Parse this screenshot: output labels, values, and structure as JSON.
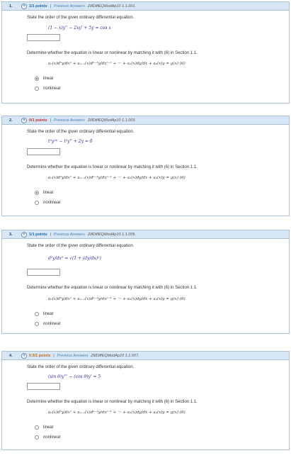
{
  "questions": [
    {
      "number": "1.",
      "points": "1/1 points",
      "prev": "Previous Answers",
      "code": "ZillDiffEQModAp10 1.1.001.",
      "prompt": "State the order of the given ordinary differential equation.",
      "equation": "(1 − x)y'' − 2xy' + 5y = cos x",
      "linear_prompt": "Determine whether the equation is linear or nonlinear by matching it with (6) in Section 1.1.",
      "general": "aₙ(x)dⁿy/dxⁿ + aₙ₋₁(x)dⁿ⁻¹y/dxⁿ⁻¹ + ··· + a₁(x)dy/dx + a₀(x)y = g(x)   (6)",
      "options": [
        "linear",
        "nonlinear"
      ],
      "selected": "linear"
    },
    {
      "number": "2.",
      "points": "0/1 points",
      "prev": "Previous Answers",
      "code": "ZillDiffEQModAp10 1.1.003.",
      "prompt": "State the order of the given ordinary differential equation.",
      "equation": "t⁵y⁽⁴⁾ − t³y'' + 2y = 0",
      "linear_prompt": "Determine whether the equation is linear or nonlinear by matching it with (6) in Section 1.1.",
      "general": "aₙ(x)dⁿy/dxⁿ + aₙ₋₁(x)dⁿ⁻¹y/dxⁿ⁻¹ + ··· + a₁(x)dy/dx + a₀(x)y = g(x)   (6)",
      "options": [
        "linear",
        "nonlinear"
      ],
      "selected": "linear"
    },
    {
      "number": "3.",
      "points": "1/1 points",
      "prev": "Previous Answers",
      "code": "ZillDiffEQModAp10 1.1.005.",
      "prompt": "State the order of the given ordinary differential equation.",
      "equation": "d²y/dx² = √(1 + (dy/dx)²)",
      "linear_prompt": "Determine whether the equation is linear or nonlinear by matching it with (6) in Section 1.1.",
      "general": "aₙ(x)dⁿy/dxⁿ + aₙ₋₁(x)dⁿ⁻¹y/dxⁿ⁻¹ + ··· + a₁(x)dy/dx + a₀(x)y = g(x)      (6)",
      "options": [
        "linear",
        "nonlinear"
      ],
      "selected": ""
    },
    {
      "number": "4.",
      "points": "0.5/1 points",
      "prev": "Previous Answers",
      "code": "ZillDiffEQModAp10 1.1.007.",
      "prompt": "State the order of the given ordinary differential equation.",
      "equation": "(sin θ)y''' − (cos θ)y' = 5",
      "linear_prompt": "Determine whether the equation is linear or nonlinear by matching it with (6) in Section 1.1.",
      "general": "aₙ(x)dⁿy/dxⁿ + aₙ₋₁(x)dⁿ⁻¹y/dxⁿ⁻¹ + ··· + a₁(x)dy/dx + a₀(x)y = g(x)   (6)",
      "options": [
        "linear",
        "nonlinear"
      ],
      "selected": ""
    }
  ]
}
